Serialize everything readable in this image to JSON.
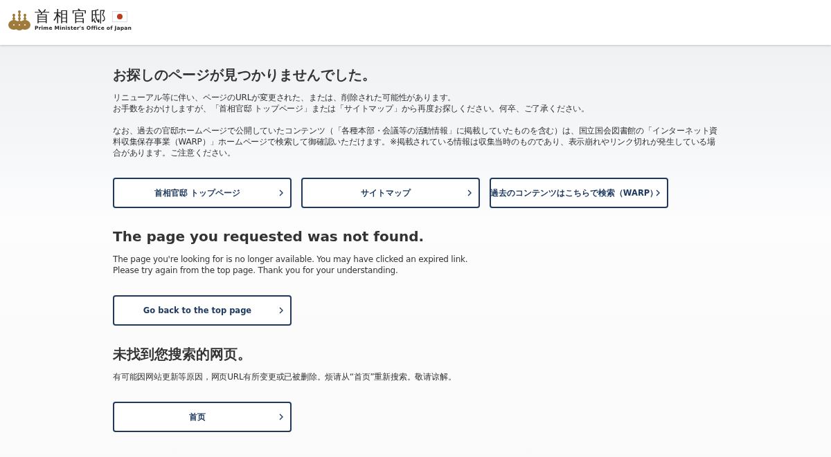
{
  "header": {
    "logo_title": "首相官邸",
    "logo_subtitle": "Prime Minister's Office of Japan"
  },
  "sections": [
    {
      "heading": "お探しのページが見つかりませんでした。",
      "paragraphs": [
        [
          "リニューアル等に伴い、ページのURLが変更された、または、削除された可能性があります。",
          "お手数をおかけしますが、「首相官邸 トップページ」または「サイトマップ」から再度お探しください。何卒、ご了承ください。"
        ],
        [
          "なお、過去の官邸ホームページで公開していたコンテンツ（「各種本部・会議等の活動情報」に掲載していたものを含む）は、国立国会図書館の「インターネット資料収集保存事業（WARP）」ホームページで検索して御確認いただけます。※掲載されている情報は収集当時のものであり、表示崩れやリンク切れが発生している場合があります。ご注意ください。"
        ]
      ],
      "buttons": [
        "首相官邸 トップページ",
        "サイトマップ",
        "過去のコンテンツはこちらで検索（WARP）"
      ]
    },
    {
      "heading": "The page you requested was not found.",
      "paragraphs": [
        [
          "The page you're looking for is no longer available. You may have clicked an expired link.",
          "Please try again from the top page. Thank you for your understanding."
        ]
      ],
      "buttons": [
        "Go back to the top page"
      ]
    },
    {
      "heading": "未找到您搜索的网页。",
      "paragraphs": [
        [
          "有可能因网站更新等原因，网页URL有所变更或已被删除。烦请从“首页”重新搜索。敬请谅解。"
        ]
      ],
      "buttons": [
        "首页"
      ]
    }
  ]
}
